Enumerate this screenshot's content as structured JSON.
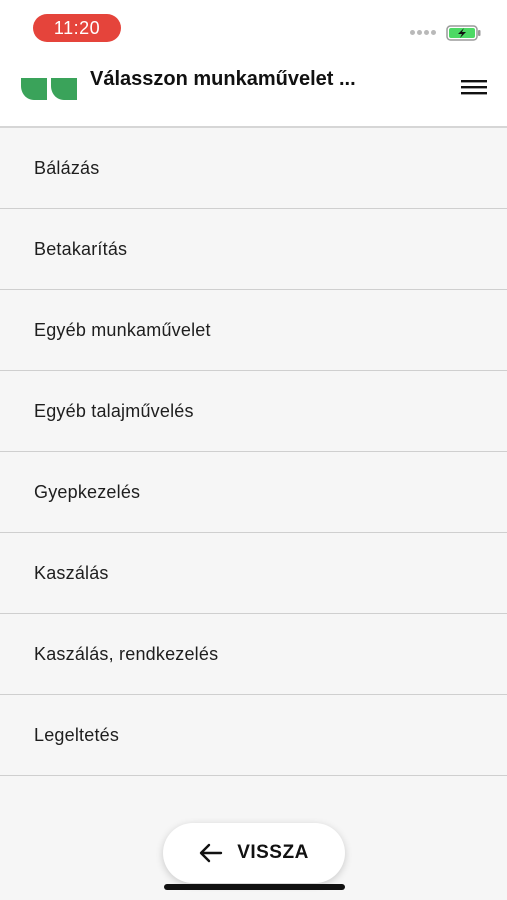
{
  "status_bar": {
    "time": "11:20",
    "battery_color": "#4cd964",
    "time_pill_color": "#e5443b"
  },
  "header": {
    "title": "Válasszon munkaművelet ...",
    "logo_icon": "app-logo-icon",
    "menu_icon": "hamburger-menu-icon",
    "logo_color": "#3aa35a"
  },
  "list": {
    "items": [
      "Bálázás",
      "Betakarítás",
      "Egyéb munkaművelet",
      "Egyéb talajművelés",
      "Gyepkezelés",
      "Kaszálás",
      "Kaszálás, rendkezelés",
      "Legeltetés"
    ]
  },
  "footer": {
    "back_label": "VISSZA",
    "back_icon": "arrow-left-icon"
  }
}
